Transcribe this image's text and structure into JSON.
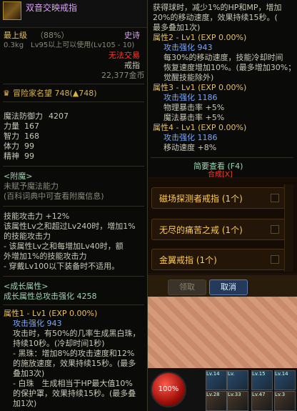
{
  "tooltip": {
    "title": "双音交映戒指",
    "level_label": "最上级",
    "level_pct": "（88%）",
    "rarity": "史诗",
    "weight_req": "0.3kg　Lv95以上可以使用(Lv105 - 10)",
    "trade": "无法交易",
    "type": "戒指",
    "price": "22,377金币",
    "fame": "冒险家名望 748(▲748)",
    "stats": [
      {
        "label": "魔法防御力",
        "value": "4207"
      },
      {
        "label": "力量",
        "value": "167"
      },
      {
        "label": "智力",
        "value": "168"
      },
      {
        "label": "体力",
        "value": "99"
      },
      {
        "label": "精神",
        "value": "99"
      }
    ],
    "enchant_title": "<附魔>",
    "enchant_none": "未赋予魔法能力",
    "enchant_hint": "(百科词典中可查看附魔信息)",
    "skill_lines": [
      "技能攻击力 +12%",
      "该属性Lv之和超过Lv240时，增加1%",
      "的技能攻击力",
      "- 该属性Lv之和每增加Lv40时，额",
      "外增加1%的技能攻击力",
      "- 穿戴Lv100以下装备时不适用。"
    ],
    "growth_title": "<成长属性>",
    "growth_total": "成长属性总攻击强化 4258",
    "attr1_title": "属性1 - Lv1 (EXP 0.00%)",
    "attr1_strength": "攻击强化 943",
    "attr1_lines": [
      "攻击时，有50%的几率生成黑白珠，",
      "持续10秒。(冷却时间1秒)",
      "- 黑珠：增加8%的攻击速度和12%",
      "的施放速度，效果持续15秒。(最多",
      "叠加3次)",
      "- 白珠　生成相当于HP最大值10%",
      "的保护罩，效果持续15秒。(最多叠",
      "加1次)"
    ]
  },
  "right_tooltip": {
    "top_lines": [
      "获得球时，减少1%的HP和MP，增加",
      "20%的移动速度，效果持续15秒。(",
      "最多叠加1次)"
    ],
    "attr2_title": "属性2 - Lv1 (EXP 0.00%)",
    "attr2_strength": "攻击强化 943",
    "attr2_lines": [
      "每30%的移动速度，技能冷却时间",
      "恢复速度增加10%。(最多增加30%；",
      "觉醒技能除外)"
    ],
    "attr3_title": "属性3 - Lv1 (EXP 0.00%)",
    "attr3_strength": "攻击强化 1186",
    "attr3_lines": [
      "物理暴击率 +5%",
      "魔法暴击率 +5%"
    ],
    "attr4_title": "属性4 - Lv1 (EXP 0.00%)",
    "attr4_strength": "攻击强化 1186",
    "attr4_lines": [
      "移动速度 +8%"
    ],
    "brief_view": "简要查看 (F4)",
    "synth": "合成[X]"
  },
  "list": {
    "items": [
      {
        "label": "磁场探测者戒指 (1个)"
      },
      {
        "label": "无尽的痛苦之戒 (1个)"
      },
      {
        "label": "金翼戒指 (1个)"
      }
    ]
  },
  "buttons": {
    "claim": "领取",
    "cancel": "取消"
  },
  "hud": {
    "hp": "100%",
    "slots_top": [
      "Lv.14",
      "Lv.",
      "Lv.15",
      "Lv.14"
    ],
    "slots_bottom": [
      "Lv.28",
      "Lv.33",
      "Lv.47",
      "Lv.3"
    ]
  }
}
